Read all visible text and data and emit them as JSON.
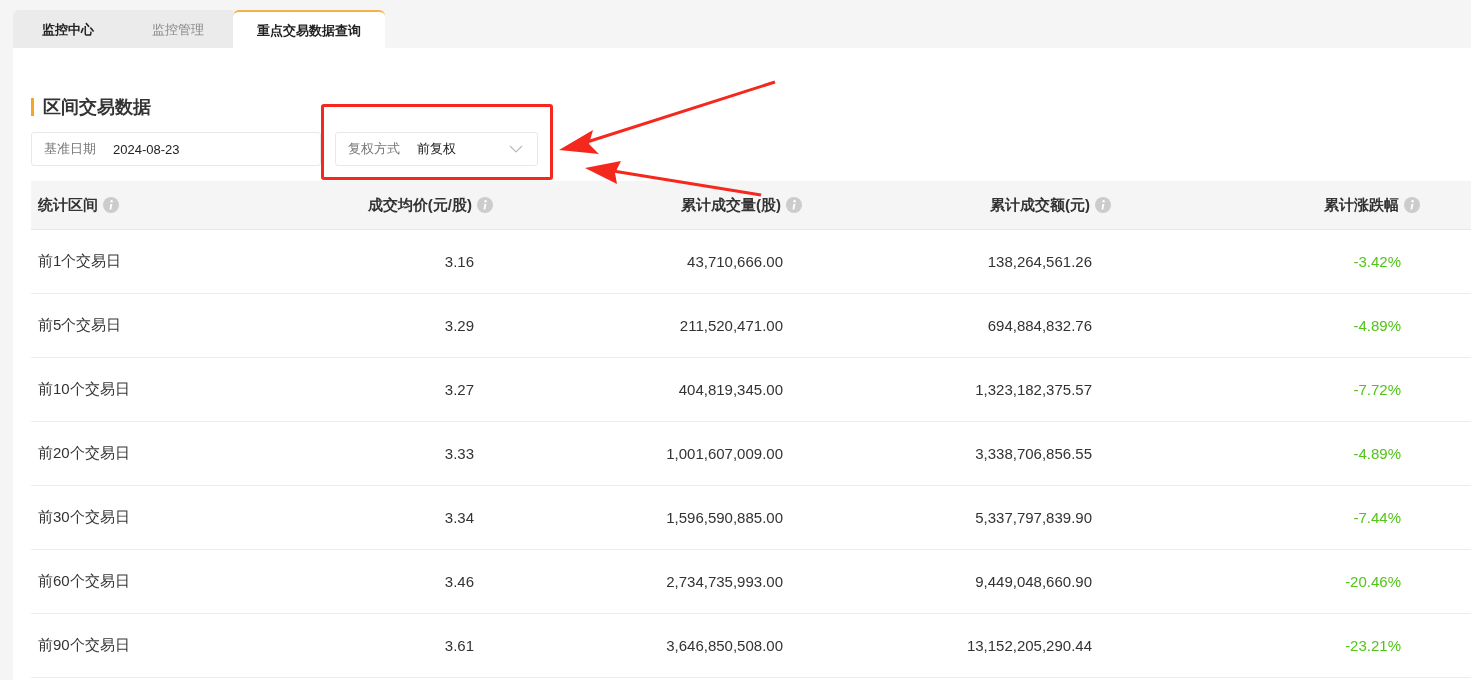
{
  "tabs": [
    {
      "label": "监控中心",
      "selected": false,
      "highlighted": true
    },
    {
      "label": "监控管理",
      "selected": false,
      "highlighted": false
    },
    {
      "label": "重点交易数据查询",
      "selected": true,
      "highlighted": false
    }
  ],
  "section_title": "区间交易数据",
  "filters": [
    {
      "kind": "date",
      "label": "基准日期",
      "value": "2024-08-23"
    },
    {
      "kind": "select",
      "label": "复权方式",
      "value": "前复权",
      "annotated": true
    }
  ],
  "table": {
    "columns": [
      {
        "label": "统计区间",
        "info": true
      },
      {
        "label": "成交均价(元/股)",
        "info": true
      },
      {
        "label": "累计成交量(股)",
        "info": true
      },
      {
        "label": "累计成交额(元)",
        "info": true
      },
      {
        "label": "累计涨跌幅",
        "info": true
      }
    ],
    "rows": [
      [
        "前1个交易日",
        "3.16",
        "43,710,666.00",
        "138,264,561.26",
        "-3.42%"
      ],
      [
        "前5个交易日",
        "3.29",
        "211,520,471.00",
        "694,884,832.76",
        "-4.89%"
      ],
      [
        "前10个交易日",
        "3.27",
        "404,819,345.00",
        "1,323,182,375.57",
        "-7.72%"
      ],
      [
        "前20个交易日",
        "3.33",
        "1,001,607,009.00",
        "3,338,706,856.55",
        "-4.89%"
      ],
      [
        "前30个交易日",
        "3.34",
        "1,596,590,885.00",
        "5,337,797,839.90",
        "-7.44%"
      ],
      [
        "前60个交易日",
        "3.46",
        "2,734,735,993.00",
        "9,449,048,660.90",
        "-20.46%"
      ],
      [
        "前90个交易日",
        "3.61",
        "3,646,850,508.00",
        "13,152,205,290.44",
        "-23.21%"
      ]
    ]
  }
}
